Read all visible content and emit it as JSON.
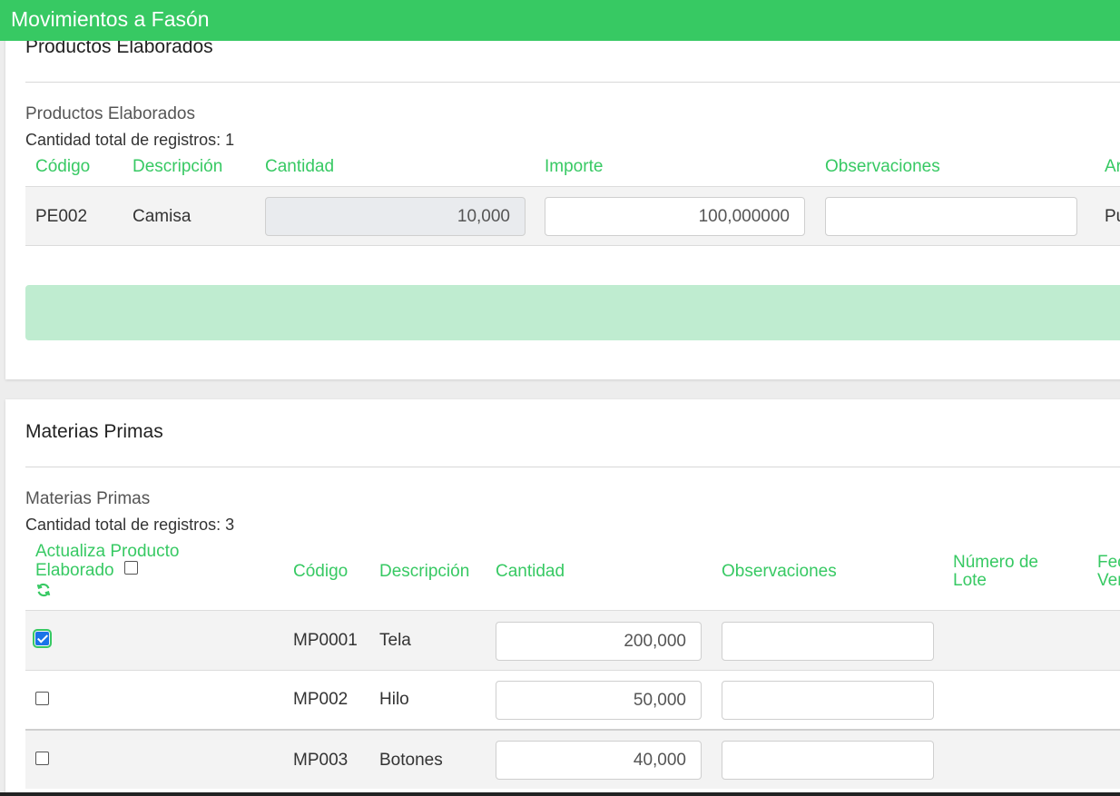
{
  "app": {
    "title": "Movimientos a Fasón"
  },
  "productos": {
    "card_title": "Productos Elaborados",
    "sub_title": "Productos Elaborados",
    "count_text": "Cantidad total de registros: 1",
    "headers": [
      "Código",
      "Descripción",
      "Cantidad",
      "Importe",
      "Observaciones",
      "Ar"
    ],
    "rows": [
      {
        "codigo": "PE002",
        "descripcion": "Camisa",
        "cantidad": "10,000",
        "importe": "100,000000",
        "observaciones": "",
        "extra": "Pu"
      }
    ]
  },
  "materias": {
    "card_title": "Materias Primas",
    "sub_title": "Materias Primas",
    "count_text": "Cantidad total de registros: 3",
    "headers": {
      "actualiza_line1": "Actualiza Producto",
      "actualiza_line2": "Elaborado",
      "codigo": "Código",
      "descripcion": "Descripción",
      "cantidad": "Cantidad",
      "observaciones": "Observaciones",
      "lote_line1": "Número de",
      "lote_line2": "Lote",
      "fec_line1": "Fec",
      "fec_line2": "Ven"
    },
    "rows": [
      {
        "checked": true,
        "codigo": "MP0001",
        "descripcion": "Tela",
        "cantidad": "200,000",
        "observaciones": ""
      },
      {
        "checked": false,
        "codigo": "MP002",
        "descripcion": "Hilo",
        "cantidad": "50,000",
        "observaciones": ""
      },
      {
        "checked": false,
        "codigo": "MP003",
        "descripcion": "Botones",
        "cantidad": "40,000",
        "observaciones": ""
      }
    ]
  },
  "colors": {
    "accent": "#37c963",
    "alert_bg": "#bfecd0"
  },
  "icons": {
    "refresh": "refresh-icon"
  }
}
